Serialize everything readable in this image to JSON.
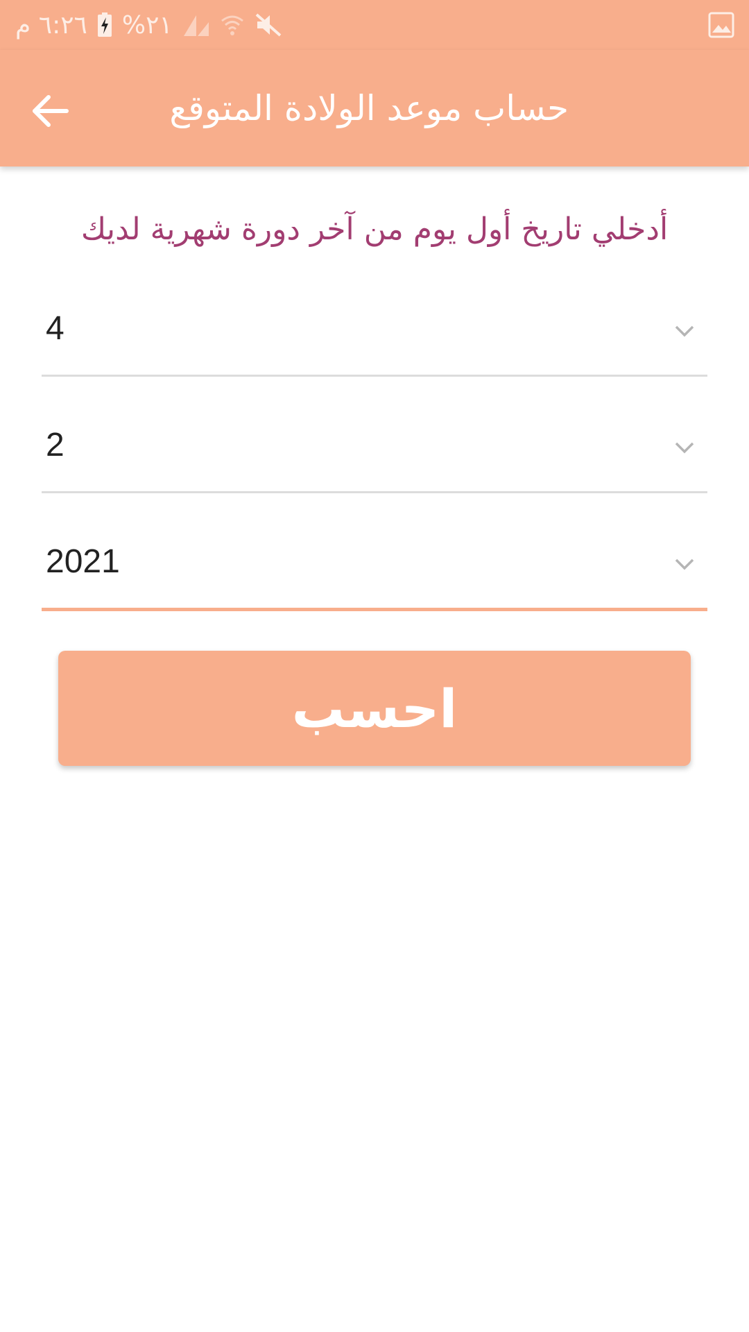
{
  "status_bar": {
    "time": "٦:٢٦ م",
    "battery": "%٢١",
    "icons": [
      "charging-battery-icon",
      "signal-icon",
      "wifi-icon",
      "mute-icon",
      "gallery-icon"
    ]
  },
  "app_bar": {
    "title": "حساب موعد الولادة المتوقع",
    "back_icon": "arrow-left-icon"
  },
  "instruction": "أدخلي تاريخ أول يوم من آخر دورة شهرية لديك",
  "dropdowns": [
    {
      "value": "4"
    },
    {
      "value": "2"
    },
    {
      "value": "2021"
    }
  ],
  "calculate_button": {
    "label": "احسب"
  },
  "colors": {
    "accent": "#f8ae8c",
    "instruction_text": "#a23d71",
    "divider": "#dcdcdc"
  }
}
